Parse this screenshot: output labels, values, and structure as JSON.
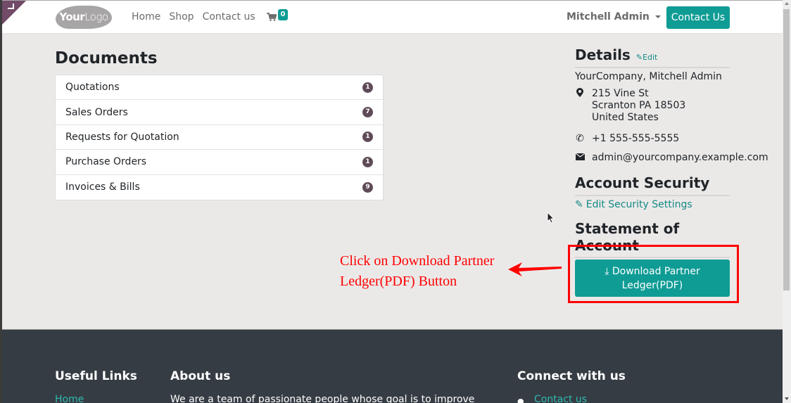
{
  "header": {
    "logo_text_bold": "Your",
    "logo_text_light": "Logo",
    "nav": [
      "Home",
      "Shop",
      "Contact us"
    ],
    "cart_count": "0",
    "user_name": "Mitchell Admin",
    "contact_button": "Contact Us"
  },
  "documents": {
    "title": "Documents",
    "items": [
      {
        "label": "Quotations",
        "count": "1"
      },
      {
        "label": "Sales Orders",
        "count": "7"
      },
      {
        "label": "Requests for Quotation",
        "count": "1"
      },
      {
        "label": "Purchase Orders",
        "count": "1"
      },
      {
        "label": "Invoices & Bills",
        "count": "9"
      }
    ]
  },
  "details": {
    "title": "Details",
    "edit_label": "Edit",
    "company": "YourCompany, Mitchell Admin",
    "address": [
      "215 Vine St",
      "Scranton PA 18503",
      "United States"
    ],
    "phone": "+1 555-555-5555",
    "email": "admin@yourcompany.example.com"
  },
  "security": {
    "title": "Account Security",
    "edit_label": "Edit Security Settings"
  },
  "statement": {
    "title": "Statement of Account",
    "button_line1": "Download Partner",
    "button_line2": "Ledger(PDF)"
  },
  "annotation": {
    "line1": "Click on Download Partner",
    "line2": "Ledger(PDF) Button",
    "color": "#ff0000"
  },
  "footer": {
    "useful_links_title": "Useful Links",
    "useful_links": [
      "Home"
    ],
    "about_title": "About us",
    "about_text": "We are a team of passionate people whose goal is to improve",
    "connect_title": "Connect with us",
    "connect_links": [
      "Contact us"
    ]
  },
  "colors": {
    "accent": "#0f9c95",
    "badge": "#5f4b57",
    "footer_bg": "#363c43",
    "corner": "#714b67"
  }
}
